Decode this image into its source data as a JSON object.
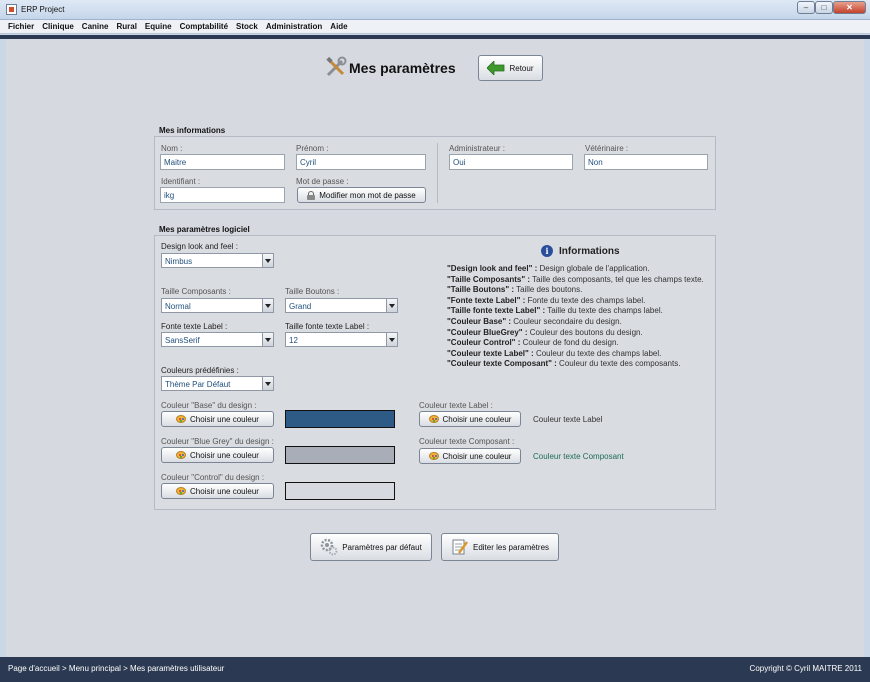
{
  "window": {
    "title": "ERP Project"
  },
  "menu": [
    "Fichier",
    "Clinique",
    "Canine",
    "Rural",
    "Equine",
    "Comptabilité",
    "Stock",
    "Administration",
    "Aide"
  ],
  "header": {
    "title": "Mes paramètres",
    "back_label": "Retour"
  },
  "infos": {
    "section_title": "Mes informations",
    "nom_label": "Nom :",
    "nom_value": "Maitre",
    "prenom_label": "Prénom :",
    "prenom_value": "Cyril",
    "identifiant_label": "Identifiant :",
    "identifiant_value": "ikg",
    "password_label": "Mot de passe :",
    "password_button": "Modifier mon mot de passe",
    "admin_label": "Administrateur :",
    "admin_value": "Oui",
    "vet_label": "Vétérinaire :",
    "vet_value": "Non"
  },
  "settings": {
    "section_title": "Mes paramètres logiciel",
    "design_label": "Design look and feel :",
    "design_value": "Nimbus",
    "taille_comp_label": "Taille Composants :",
    "taille_comp_value": "Normal",
    "taille_btn_label": "Taille Boutons :",
    "taille_btn_value": "Grand",
    "font_label": "Fonte texte Label :",
    "font_value": "SansSerif",
    "font_size_label": "Taille fonte texte Label :",
    "font_size_value": "12",
    "preset_label": "Couleurs prédéfinies :",
    "preset_value": "Thème Par Défaut",
    "base_label": "Couleur \"Base\" du design :",
    "bluegrey_label": "Couleur \"Blue Grey\" du design :",
    "control_label": "Couleur \"Control\" du design :",
    "choose_label": "Choisir une couleur",
    "text_label_label": "Couleur texte Label :",
    "text_label_preview": "Couleur texte Label",
    "text_comp_label": "Couleur texte Composant :",
    "text_comp_preview": "Couleur texte Composant",
    "colors": {
      "base": "#2e5b86",
      "bluegrey": "#a9adb8",
      "control": "#d6d9df",
      "text_label": "#333333",
      "text_comp": "#1f6b5a"
    }
  },
  "informations": {
    "title": "Informations",
    "lines": [
      {
        "key": "\"Design look and feel\" :",
        "desc": " Design globale de l'application."
      },
      {
        "key": "\"Taille Composants\" :",
        "desc": " Taille des composants, tel que les champs texte."
      },
      {
        "key": "\"Taille Boutons\" :",
        "desc": " Taille des boutons."
      },
      {
        "key": "\"Fonte texte Label\" :",
        "desc": " Fonte du texte des champs label."
      },
      {
        "key": "\"Taille fonte texte Label\" :",
        "desc": " Taille du texte des champs label."
      },
      {
        "key": "\"Couleur Base\" :",
        "desc": " Couleur secondaire du design."
      },
      {
        "key": "\"Couleur BlueGrey\" :",
        "desc": " Couleur des boutons du design."
      },
      {
        "key": "\"Couleur Control\" :",
        "desc": " Couleur de fond du design."
      },
      {
        "key": "\"Couleur texte Label\" :",
        "desc": " Couleur du texte des champs label."
      },
      {
        "key": "\"Couleur texte Composant\" :",
        "desc": " Couleur du texte des composants."
      }
    ]
  },
  "actions": {
    "defaults_label": "Paramètres par défaut",
    "edit_label": "Editer les paramètres"
  },
  "status": {
    "breadcrumb": "Page d'accueil > Menu principal > Mes paramètres utilisateur",
    "copyright": "Copyright © Cyril MAITRE 2011"
  }
}
